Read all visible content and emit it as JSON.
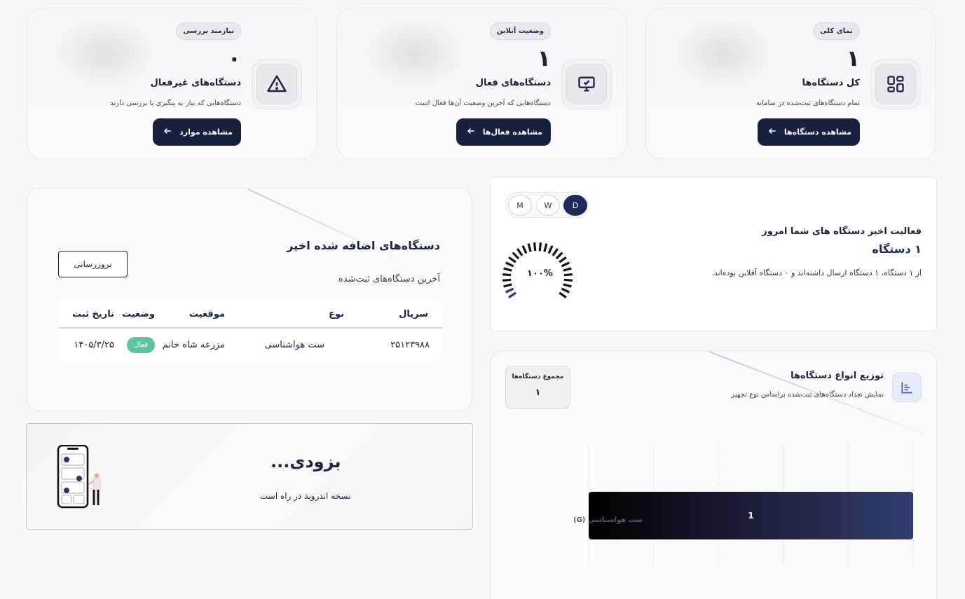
{
  "stats": [
    {
      "badge": "نمای کلی",
      "value": "۱",
      "title": "کل دستگاه‌ها",
      "desc": "تمام دستگاه‌های ثبت‌شده در سامانه",
      "button": "مشاهده دستگاه‌ها",
      "icon": "grid-icon"
    },
    {
      "badge": "وضعیت آنلاین",
      "value": "۱",
      "title": "دستگاه‌های فعال",
      "desc": "دستگاه‌هایی که آخرین وضعیت آن‌ها فعال است",
      "button": "مشاهده فعال‌ها",
      "icon": "monitor-check-icon"
    },
    {
      "badge": "نیازمند بررسی",
      "value": "۰",
      "title": "دستگاه‌های غیرفعال",
      "desc": "دستگاه‌هایی که نیاز به پیگیری یا بررسی دارند",
      "button": "مشاهده موارد",
      "icon": "warning-icon"
    }
  ],
  "recent": {
    "title": "دستگاه‌های اضافه شده اخیر",
    "subtitle": "آخرین دستگاه‌های ثبت‌شده",
    "refresh": "بروزرسانی",
    "columns": [
      "سریال",
      "نوع",
      "موقعیت",
      "وضعیت",
      "تاریخ ثبت"
    ],
    "rows": [
      {
        "serial": "۲۵۱۲۳۹۸۸",
        "type": "ست هواشناسی",
        "location": "مزرعه شاه خانم",
        "status": "فعال",
        "date": "۱۴۰۵/۳/۲۵"
      }
    ]
  },
  "soon": {
    "title": "بزودی...",
    "subtitle": "نسخه اندروید در راه است"
  },
  "activity": {
    "periods": [
      "M",
      "W",
      "D"
    ],
    "active_period": "D",
    "title": "فعالیت اخیر دستگاه های شما امروز",
    "count": "۱ دستگاه",
    "desc": "از ۱ دستگاه، ۱ دستگاه ارسال داشته‌اند و ۰ دستگاه آفلاین بوده‌اند.",
    "gauge_label": "۱۰۰%",
    "gauge_fraction": 1.0
  },
  "distribution": {
    "title": "توزیع انواع دستگاه‌ها",
    "subtitle": "نمایش تعداد دستگاه‌های ثبت‌شده براساس نوع تجهیز",
    "total_label": "مجموع دستگاه‌ها",
    "total_value": "۱"
  },
  "chart_data": {
    "type": "bar",
    "orientation": "horizontal",
    "categories": [
      "ست هواشناسی (G)"
    ],
    "values": [
      1
    ],
    "value_labels": [
      "1"
    ],
    "xlim": [
      0,
      1
    ],
    "grid": true,
    "colors": [
      "#000000",
      "#343c6e"
    ]
  }
}
